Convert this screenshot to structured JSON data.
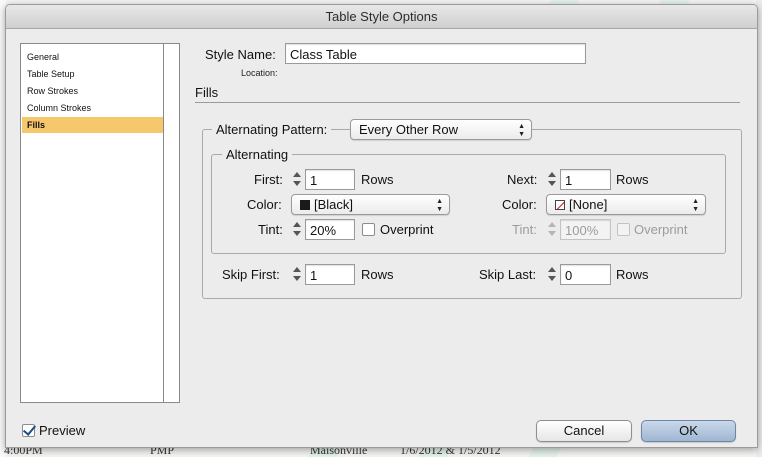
{
  "background": {
    "bottom_fragments": [
      "4:00PM",
      "PMP",
      "Maisonville",
      "1/6/2012 & 1/5/2012"
    ]
  },
  "window": {
    "title": "Table Style Options"
  },
  "sidebar": {
    "items": [
      {
        "label": "General",
        "active": false
      },
      {
        "label": "Table Setup",
        "active": false
      },
      {
        "label": "Row Strokes",
        "active": false
      },
      {
        "label": "Column Strokes",
        "active": false
      },
      {
        "label": "Fills",
        "active": true
      }
    ]
  },
  "style": {
    "name_label": "Style Name:",
    "name_value": "Class Table",
    "location_label": "Location:"
  },
  "section": {
    "title": "Fills"
  },
  "fills": {
    "alternating_pattern_label": "Alternating Pattern:",
    "alternating_pattern_value": "Every Other Row",
    "group_title": "Alternating",
    "first": {
      "label": "First:",
      "value": "1",
      "unit": "Rows",
      "color_label": "Color:",
      "color_value": "[Black]",
      "color_swatch": "#1a1a1a",
      "tint_label": "Tint:",
      "tint_value": "20%",
      "overprint_label": "Overprint",
      "overprint_checked": false
    },
    "next": {
      "label": "Next:",
      "value": "1",
      "unit": "Rows",
      "color_label": "Color:",
      "color_value": "[None]",
      "color_swatch": "none",
      "tint_label": "Tint:",
      "tint_value": "100%",
      "overprint_label": "Overprint",
      "overprint_checked": false,
      "tint_disabled": true
    },
    "skip_first": {
      "label": "Skip First:",
      "value": "1",
      "unit": "Rows"
    },
    "skip_last": {
      "label": "Skip Last:",
      "value": "0",
      "unit": "Rows"
    }
  },
  "footer": {
    "preview_label": "Preview",
    "preview_checked": true,
    "cancel_label": "Cancel",
    "ok_label": "OK"
  },
  "colors": {
    "selection_highlight": "#f6c76b",
    "default_button": "#a9bfd8",
    "dialog_background": "#ececec"
  }
}
